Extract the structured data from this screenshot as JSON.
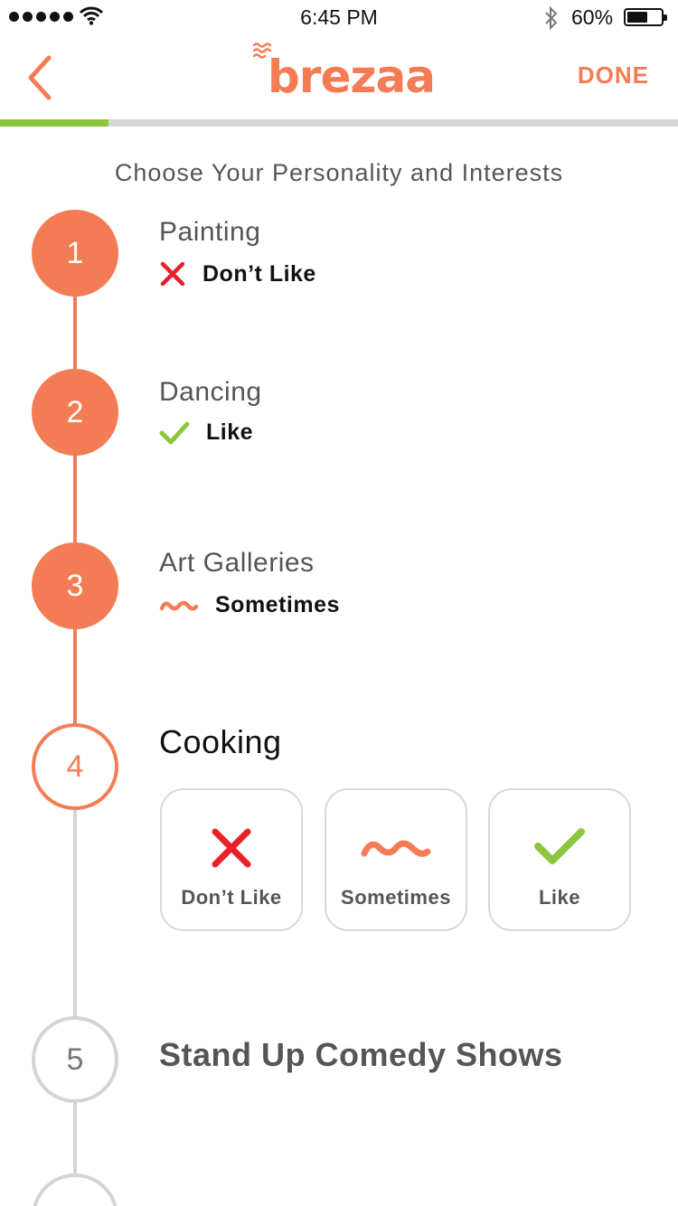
{
  "status_bar": {
    "time": "6:45 PM",
    "battery_percent": "60%",
    "battery_level": 0.6,
    "icons": [
      "signal-dots-icon",
      "wifi-icon",
      "bluetooth-icon",
      "battery-icon"
    ]
  },
  "nav": {
    "back_icon": "chevron-left-icon",
    "logo_text": "brezaa",
    "done_label": "DONE"
  },
  "progress": {
    "value": 0.16
  },
  "page_title": "Choose Your Personality and Interests",
  "colors": {
    "accent": "#f47c55",
    "like": "#8cc63f",
    "dislike": "#e8202a",
    "inactive": "#d4d4d4"
  },
  "steps": [
    {
      "number": "1",
      "title": "Painting",
      "answer": "Don’t Like",
      "answer_icon": "x-icon",
      "state": "done"
    },
    {
      "number": "2",
      "title": "Dancing",
      "answer": "Like",
      "answer_icon": "check-icon",
      "state": "done"
    },
    {
      "number": "3",
      "title": "Art Galleries",
      "answer": "Sometimes",
      "answer_icon": "wave-icon",
      "state": "done"
    },
    {
      "number": "4",
      "title": "Cooking",
      "state": "current"
    },
    {
      "number": "5",
      "title": "Stand Up Comedy Shows",
      "state": "todo"
    }
  ],
  "options": [
    {
      "label": "Don’t Like",
      "icon": "x-icon"
    },
    {
      "label": "Sometimes",
      "icon": "wave-icon"
    },
    {
      "label": "Like",
      "icon": "check-icon"
    }
  ]
}
